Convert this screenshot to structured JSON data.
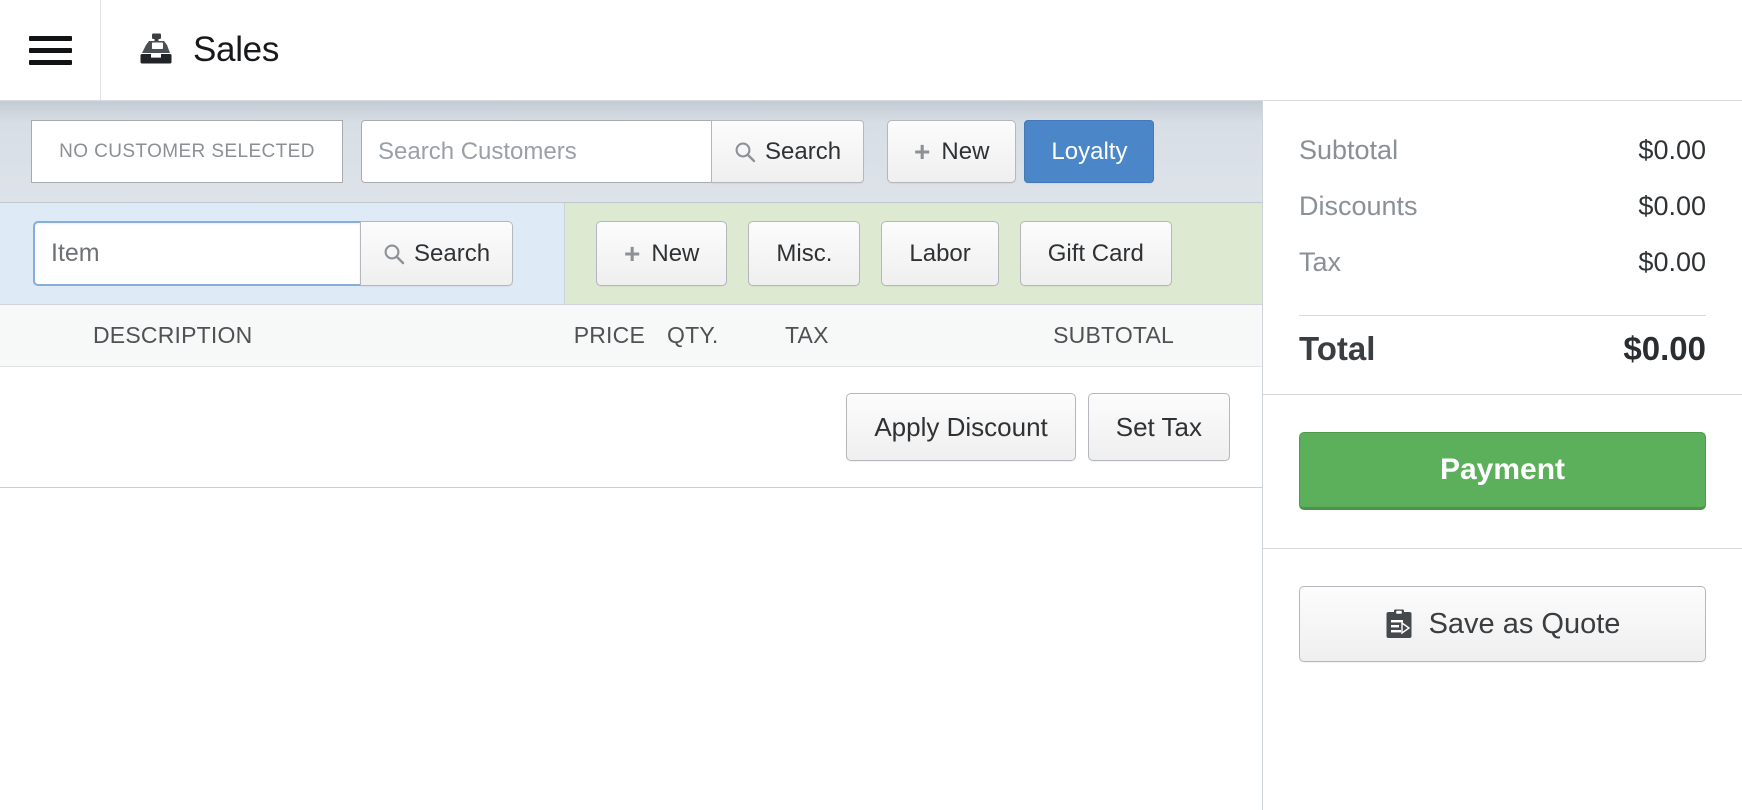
{
  "header": {
    "menu_icon": "hamburger-menu-icon",
    "app_icon": "cash-register-icon",
    "title": "Sales"
  },
  "customer_bar": {
    "selected_customer": "NO CUSTOMER SELECTED",
    "search_placeholder": "Search Customers",
    "search_value": "",
    "search_button": "Search",
    "search_icon": "magnifier-icon",
    "new_button": "New",
    "new_icon": "plus-icon",
    "loyalty_button": "Loyalty",
    "loyalty_color": "#4a86c8"
  },
  "item_bar": {
    "item_placeholder": "Item",
    "item_value": "",
    "search_button": "Search",
    "search_icon": "magnifier-icon",
    "quick_buttons": [
      {
        "label": "New",
        "icon": "plus-icon"
      },
      {
        "label": "Misc.",
        "icon": ""
      },
      {
        "label": "Labor",
        "icon": ""
      },
      {
        "label": "Gift Card",
        "icon": ""
      }
    ]
  },
  "cart_table": {
    "columns": [
      "DESCRIPTION",
      "PRICE",
      "QTY.",
      "TAX",
      "SUBTOTAL"
    ],
    "rows": [],
    "actions": {
      "apply_discount": "Apply Discount",
      "set_tax": "Set Tax"
    }
  },
  "summary": {
    "lines": [
      {
        "label": "Subtotal",
        "value": "$0.00"
      },
      {
        "label": "Discounts",
        "value": "$0.00"
      },
      {
        "label": "Tax",
        "value": "$0.00"
      }
    ],
    "total": {
      "label": "Total",
      "value": "$0.00"
    },
    "payment_button": "Payment",
    "payment_color": "#5cb05c",
    "quote_button": "Save as Quote",
    "quote_icon": "clipboard-icon"
  }
}
